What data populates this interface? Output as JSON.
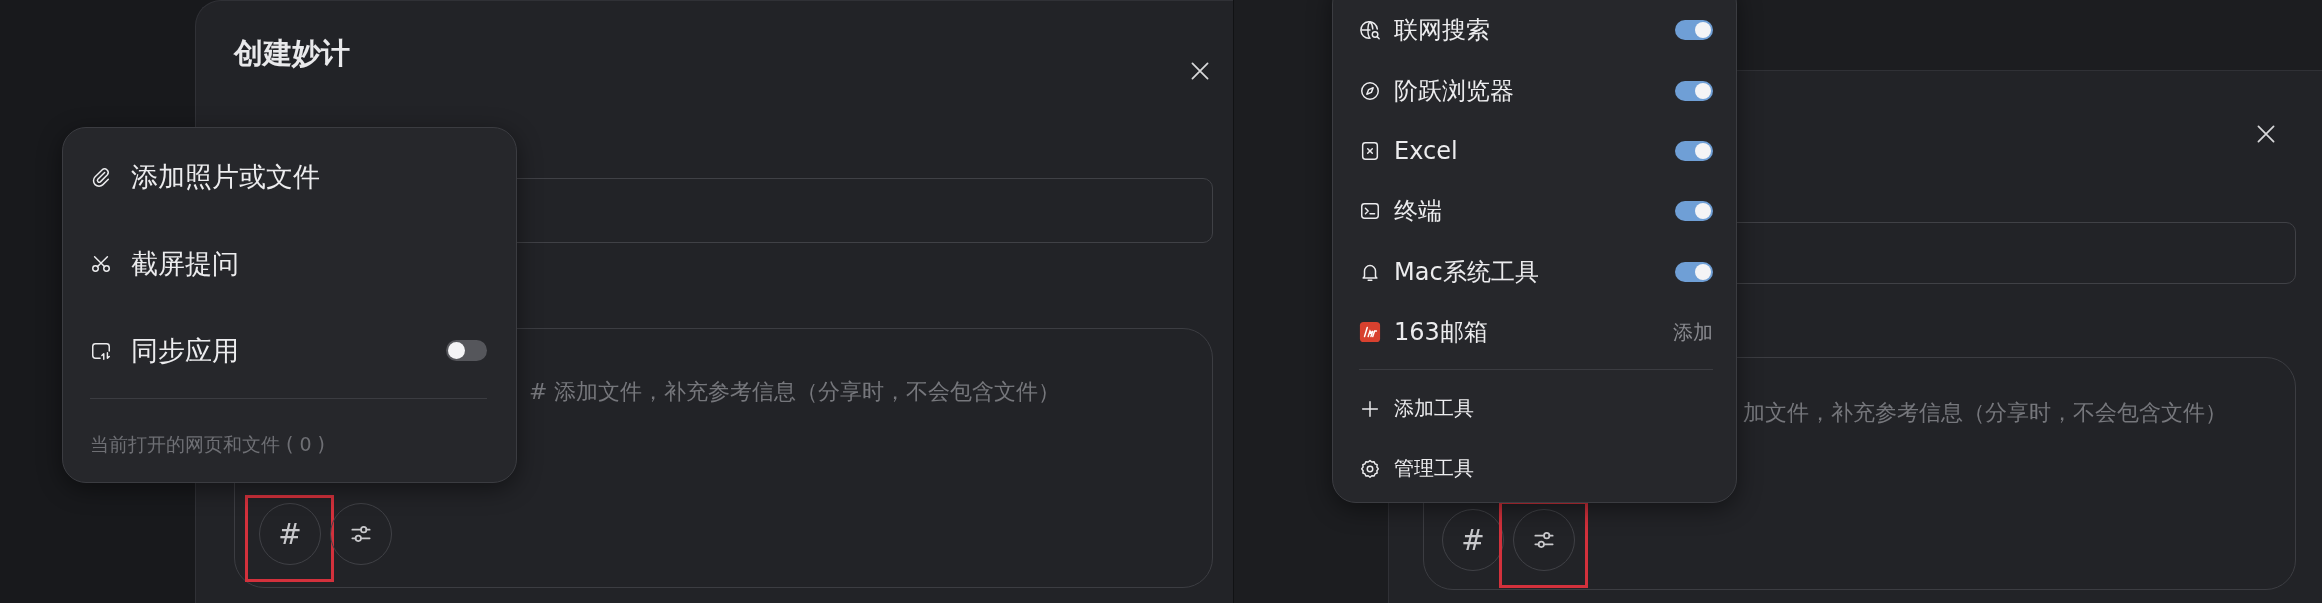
{
  "left_view": {
    "dialog": {
      "title": "创建妙计",
      "note_placeholder": "# 添加文件，补充参考信息（分享时，不会包含文件）",
      "tool_buttons": [
        {
          "kind": "hash",
          "label": "#",
          "highlighted": true
        },
        {
          "kind": "sliders",
          "highlighted": false
        }
      ]
    },
    "menu": {
      "items": [
        {
          "kind": "action",
          "label": "添加照片或文件"
        },
        {
          "kind": "action",
          "label": "截屏提问"
        },
        {
          "kind": "toggle",
          "label": "同步应用",
          "on": false
        }
      ],
      "footer": "当前打开的网页和文件 ( 0 )"
    }
  },
  "right_view": {
    "dialog": {
      "note_placeholder": "加文件，补充参考信息（分享时，不会包含文件）",
      "tool_buttons": [
        {
          "kind": "hash",
          "label": "#",
          "highlighted": false
        },
        {
          "kind": "sliders",
          "highlighted": true
        }
      ]
    },
    "menu": {
      "tools": [
        {
          "kind": "toggle",
          "label": "联网搜索",
          "on": true
        },
        {
          "kind": "toggle",
          "label": "阶跃浏览器",
          "on": true
        },
        {
          "kind": "toggle",
          "label": "Excel",
          "on": true
        },
        {
          "kind": "toggle",
          "label": "终端",
          "on": true
        },
        {
          "kind": "toggle",
          "label": "Mac系统工具",
          "on": true
        },
        {
          "kind": "add",
          "label": "163邮箱",
          "action": "添加"
        }
      ],
      "actions": [
        {
          "label": "添加工具"
        },
        {
          "label": "管理工具"
        }
      ]
    }
  }
}
